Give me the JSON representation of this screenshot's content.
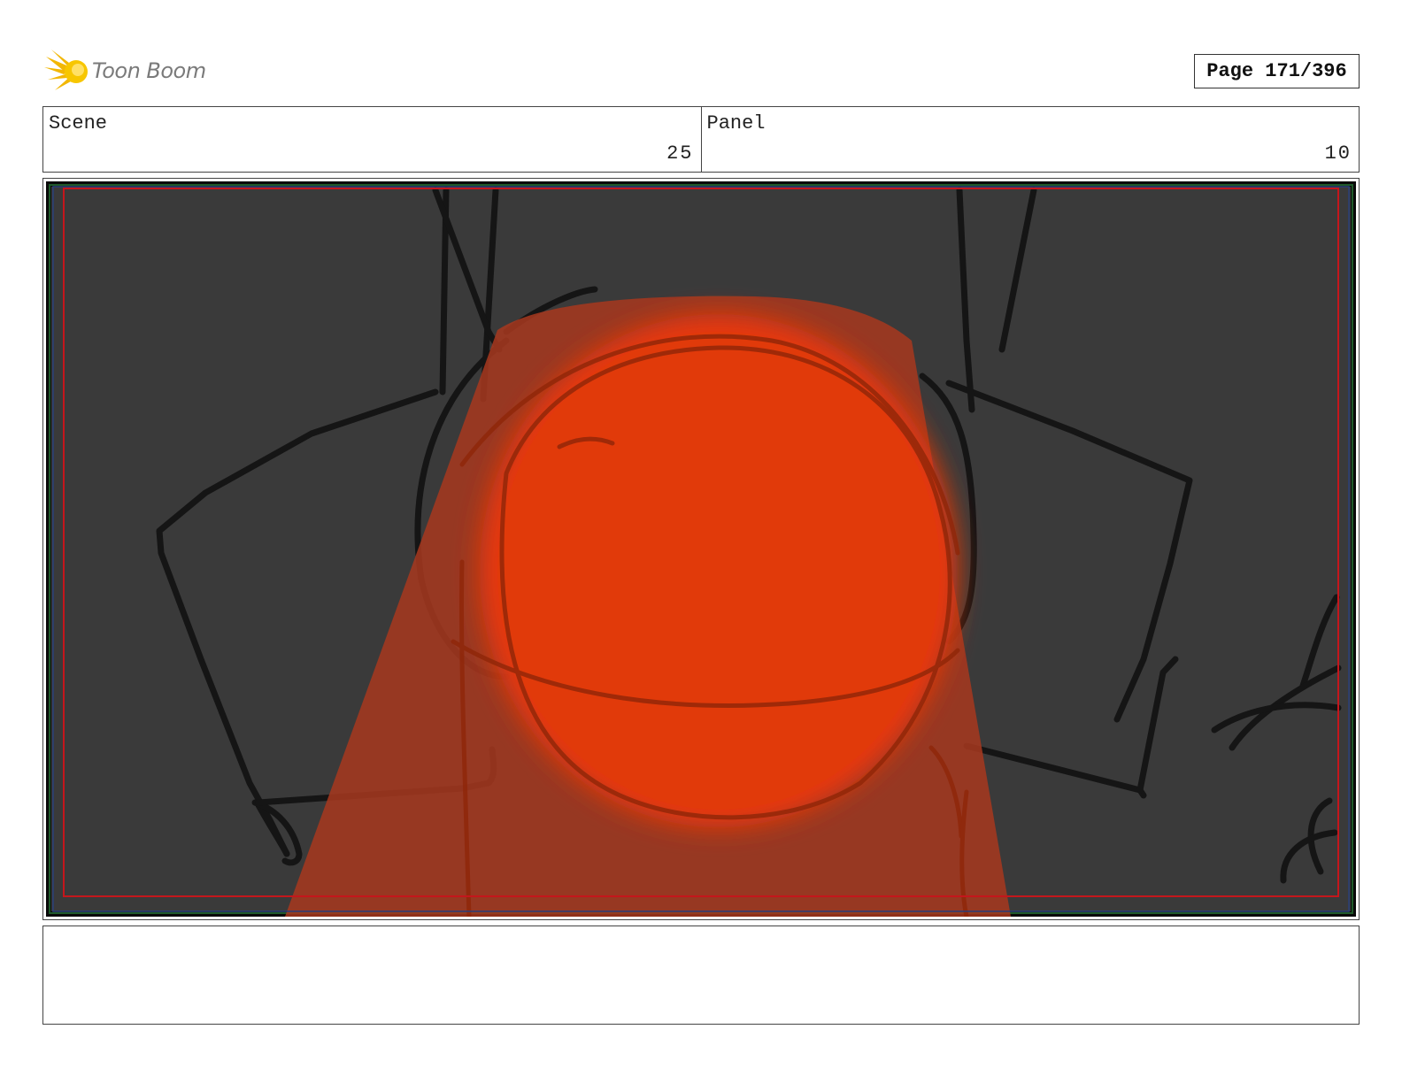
{
  "header": {
    "logo_text": "Toon Boom",
    "page_label": "Page 171/396"
  },
  "info": {
    "scene_label": "Scene",
    "scene_value": "25",
    "panel_label": "Panel",
    "panel_value": "10"
  },
  "panel": {
    "icon": "storyboard-sketch",
    "background_color": "#3a3a3a",
    "glow_color": "#e8380a",
    "beam_color": "#a8381e"
  },
  "notes": {
    "text": ""
  }
}
